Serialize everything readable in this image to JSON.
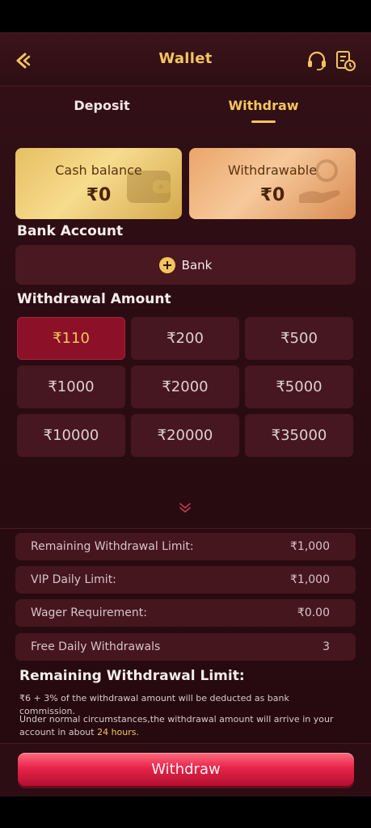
{
  "header": {
    "title": "Wallet",
    "back_icon": "chevron-left-icon",
    "support_icon": "headset-icon",
    "record_icon": "document-clock-icon"
  },
  "tabs": [
    {
      "label": "Deposit",
      "active": false
    },
    {
      "label": "Withdraw",
      "active": true
    }
  ],
  "balance": {
    "cash_label": "Cash balance",
    "cash_value": "₹0",
    "withdrawable_label": "Withdrawable",
    "withdrawable_value": "₹0"
  },
  "bank": {
    "title": "Bank Account",
    "button_label": "Bank"
  },
  "amount": {
    "title": "Withdrawal Amount",
    "options": [
      "₹110",
      "₹200",
      "₹500",
      "₹1000",
      "₹2000",
      "₹5000",
      "₹10000",
      "₹20000",
      "₹35000"
    ],
    "selected": "₹110"
  },
  "limits": [
    {
      "label": "Remaining Withdrawal Limit:",
      "value": "₹1,000"
    },
    {
      "label": "VIP Daily Limit:",
      "value": "₹1,000"
    },
    {
      "label": "Wager Requirement:",
      "value": "₹0.00"
    },
    {
      "label": "Free Daily Withdrawals",
      "value": "3"
    }
  ],
  "notes": {
    "title": "Remaining Withdrawal Limit:",
    "commission": "₹6 + 3% of the withdrawal amount will be deducted as bank commission.",
    "arrival_prefix": "Under normal circumstances,the withdrawal amount will arrive in your account in about ",
    "arrival_highlight": "24 hours",
    "arrival_suffix": "."
  },
  "action": {
    "withdraw_label": "Withdraw"
  },
  "colors": {
    "accent_gold": "#f2c55d",
    "background": "#2a0c12",
    "selected_amount": "#8c1128",
    "button_red": "#e8244a"
  }
}
